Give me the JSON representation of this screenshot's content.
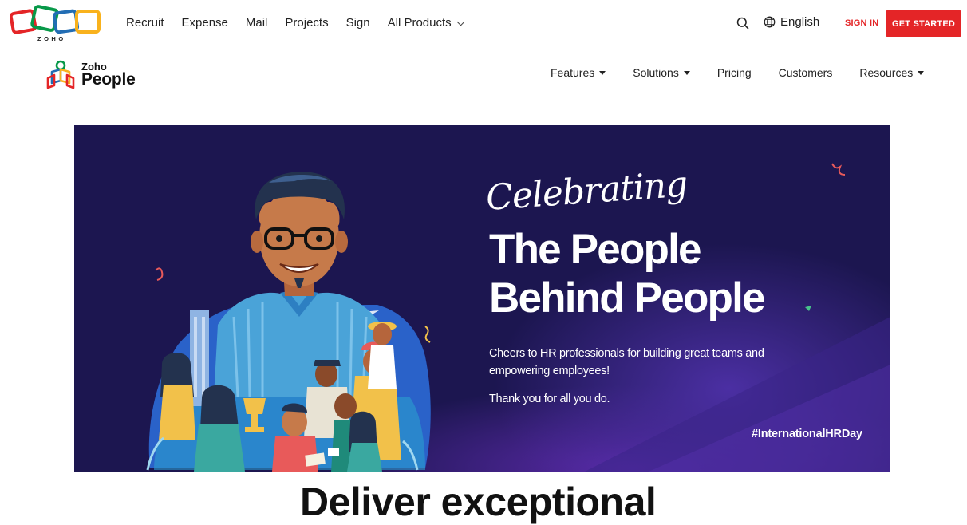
{
  "topbar": {
    "logo_text": "ZOHO",
    "nav": [
      "Recruit",
      "Expense",
      "Mail",
      "Projects",
      "Sign",
      "All Products"
    ],
    "language": "English",
    "signin": "SIGN IN",
    "get_started": "GET STARTED",
    "icons": [
      "search-icon",
      "globe-icon",
      "chevron-down-icon"
    ]
  },
  "product": {
    "logo_small": "Zoho",
    "logo_big": "People",
    "nav": [
      "Features",
      "Solutions",
      "Pricing",
      "Customers",
      "Resources"
    ]
  },
  "hero": {
    "script_title": "Celebrating",
    "headline_line1": "The People",
    "headline_line2": "Behind People",
    "body": "Cheers to HR professionals for building great teams and empowering employees!",
    "thanks": "Thank you for all you do.",
    "hashtag": "#InternationalHRDay"
  },
  "section": {
    "heading": "Deliver exceptional"
  },
  "colors": {
    "brand_red": "#e42527",
    "hero_bg": "#1c1650",
    "zoho_red": "#e42527",
    "zoho_green": "#089949",
    "zoho_blue": "#226db4",
    "zoho_yellow": "#f9b21d"
  }
}
